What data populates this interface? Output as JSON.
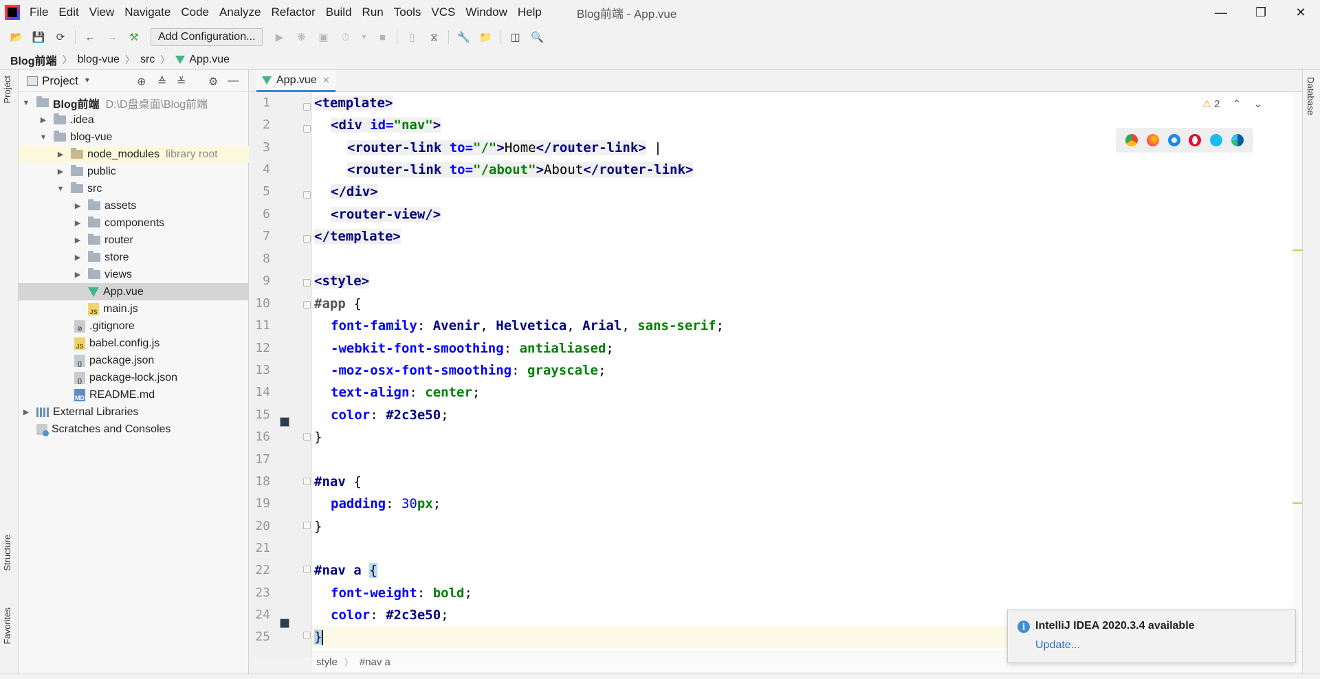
{
  "menubar": {
    "items": [
      "File",
      "Edit",
      "View",
      "Navigate",
      "Code",
      "Analyze",
      "Refactor",
      "Build",
      "Run",
      "Tools",
      "VCS",
      "Window",
      "Help"
    ],
    "title": "Blog前端 - App.vue"
  },
  "toolbar": {
    "add_config_label": "Add Configuration..."
  },
  "breadcrumb": {
    "root": "Blog前端",
    "items": [
      "blog-vue",
      "src",
      "App.vue"
    ]
  },
  "side_tabs": {
    "project": "Project",
    "structure": "Structure",
    "favorites": "Favorites",
    "database": "Database"
  },
  "project_panel": {
    "title": "Project",
    "tree": [
      {
        "label": "Blog前端",
        "hint": "D:\\D盘桌面\\Blog前端"
      },
      {
        "label": ".idea"
      },
      {
        "label": "blog-vue"
      },
      {
        "label": "node_modules",
        "hint": "library root"
      },
      {
        "label": "public"
      },
      {
        "label": "src"
      },
      {
        "label": "assets"
      },
      {
        "label": "components"
      },
      {
        "label": "router"
      },
      {
        "label": "store"
      },
      {
        "label": "views"
      },
      {
        "label": "App.vue"
      },
      {
        "label": "main.js"
      },
      {
        "label": ".gitignore"
      },
      {
        "label": "babel.config.js"
      },
      {
        "label": "package.json"
      },
      {
        "label": "package-lock.json"
      },
      {
        "label": "README.md"
      },
      {
        "label": "External Libraries"
      },
      {
        "label": "Scratches and Consoles"
      }
    ]
  },
  "editor": {
    "tab_label": "App.vue",
    "warning_count": "2",
    "line_numbers": [
      "1",
      "2",
      "3",
      "4",
      "5",
      "6",
      "7",
      "8",
      "9",
      "10",
      "11",
      "12",
      "13",
      "14",
      "15",
      "16",
      "17",
      "18",
      "19",
      "20",
      "21",
      "22",
      "23",
      "24",
      "25"
    ],
    "code_breadcrumb": [
      "style",
      "#nav a"
    ]
  },
  "notification": {
    "title": "IntelliJ IDEA 2020.3.4 available",
    "link": "Update..."
  },
  "colors": {
    "swatch": "#2c3e50",
    "accent": "#4083c9",
    "vue_green": "#41b883"
  }
}
